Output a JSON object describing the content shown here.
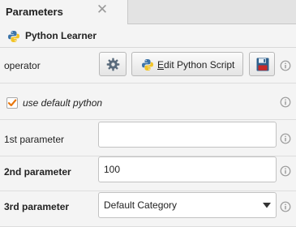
{
  "tab": {
    "title": "Parameters",
    "close_glyph": "✕"
  },
  "operator_header": {
    "icon": "python-icon",
    "title": "Python Learner"
  },
  "operator_row": {
    "label": "operator",
    "settings_icon": "gear-icon",
    "edit_button_prefix": "E",
    "edit_button_rest": "dit Python Script",
    "save_icon": "floppy-disk-icon"
  },
  "use_default_python": {
    "label": "use default python",
    "checked": true
  },
  "params": [
    {
      "label": "1st parameter",
      "value": ""
    },
    {
      "label": "2nd parameter",
      "value": "100"
    },
    {
      "label": "3rd parameter",
      "value": "Default Category"
    }
  ],
  "colors": {
    "check_orange": "#e8770e",
    "python_blue": "#3c74a8",
    "python_yellow": "#f2c427",
    "info_gray": "#9a9a9a"
  }
}
